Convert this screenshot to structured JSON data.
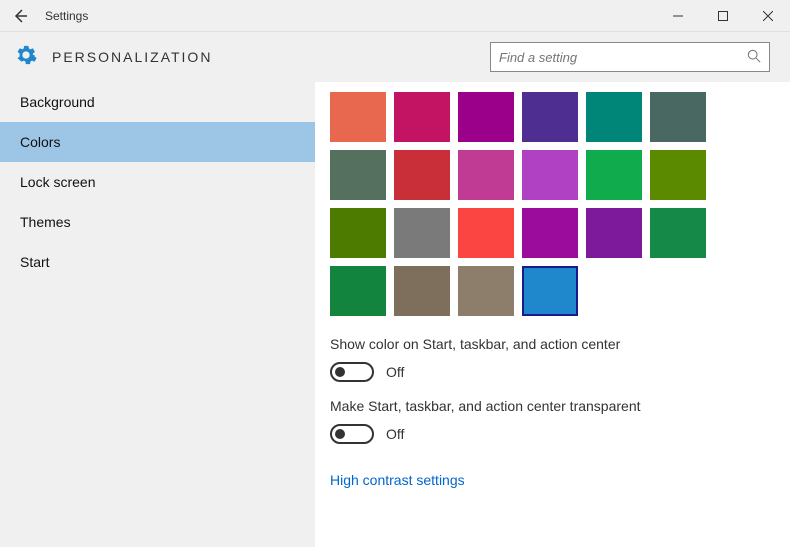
{
  "window": {
    "title": "Settings"
  },
  "header": {
    "title": "PERSONALIZATION",
    "search_placeholder": "Find a setting"
  },
  "sidebar": {
    "items": [
      {
        "label": "Background",
        "active": false
      },
      {
        "label": "Colors",
        "active": true
      },
      {
        "label": "Lock screen",
        "active": false
      },
      {
        "label": "Themes",
        "active": false
      },
      {
        "label": "Start",
        "active": false
      }
    ]
  },
  "colors": {
    "swatches": [
      {
        "hex": "#e7684e",
        "selected": false
      },
      {
        "hex": "#c31363",
        "selected": false
      },
      {
        "hex": "#9a0089",
        "selected": false
      },
      {
        "hex": "#4e2e91",
        "selected": false
      },
      {
        "hex": "#008579",
        "selected": false
      },
      {
        "hex": "#486861",
        "selected": false
      },
      {
        "hex": "#567060",
        "selected": false
      },
      {
        "hex": "#c82f39",
        "selected": false
      },
      {
        "hex": "#bf3b94",
        "selected": false
      },
      {
        "hex": "#b041c2",
        "selected": false
      },
      {
        "hex": "#0fab4d",
        "selected": false
      },
      {
        "hex": "#5b8a00",
        "selected": false
      },
      {
        "hex": "#4c7b00",
        "selected": false
      },
      {
        "hex": "#7a7a7a",
        "selected": false
      },
      {
        "hex": "#fb4543",
        "selected": false
      },
      {
        "hex": "#9c0c9c",
        "selected": false
      },
      {
        "hex": "#7d1a9b",
        "selected": false
      },
      {
        "hex": "#158a48",
        "selected": false
      },
      {
        "hex": "#13843e",
        "selected": false
      },
      {
        "hex": "#7d6f5b",
        "selected": false
      },
      {
        "hex": "#8c7e6a",
        "selected": false
      },
      {
        "hex": "#1f87cc",
        "selected": true
      }
    ]
  },
  "settings": {
    "show_color": {
      "label": "Show color on Start, taskbar, and action center",
      "state": "Off"
    },
    "transparent": {
      "label": "Make Start, taskbar, and action center transparent",
      "state": "Off"
    },
    "high_contrast": {
      "label": "High contrast settings"
    }
  }
}
